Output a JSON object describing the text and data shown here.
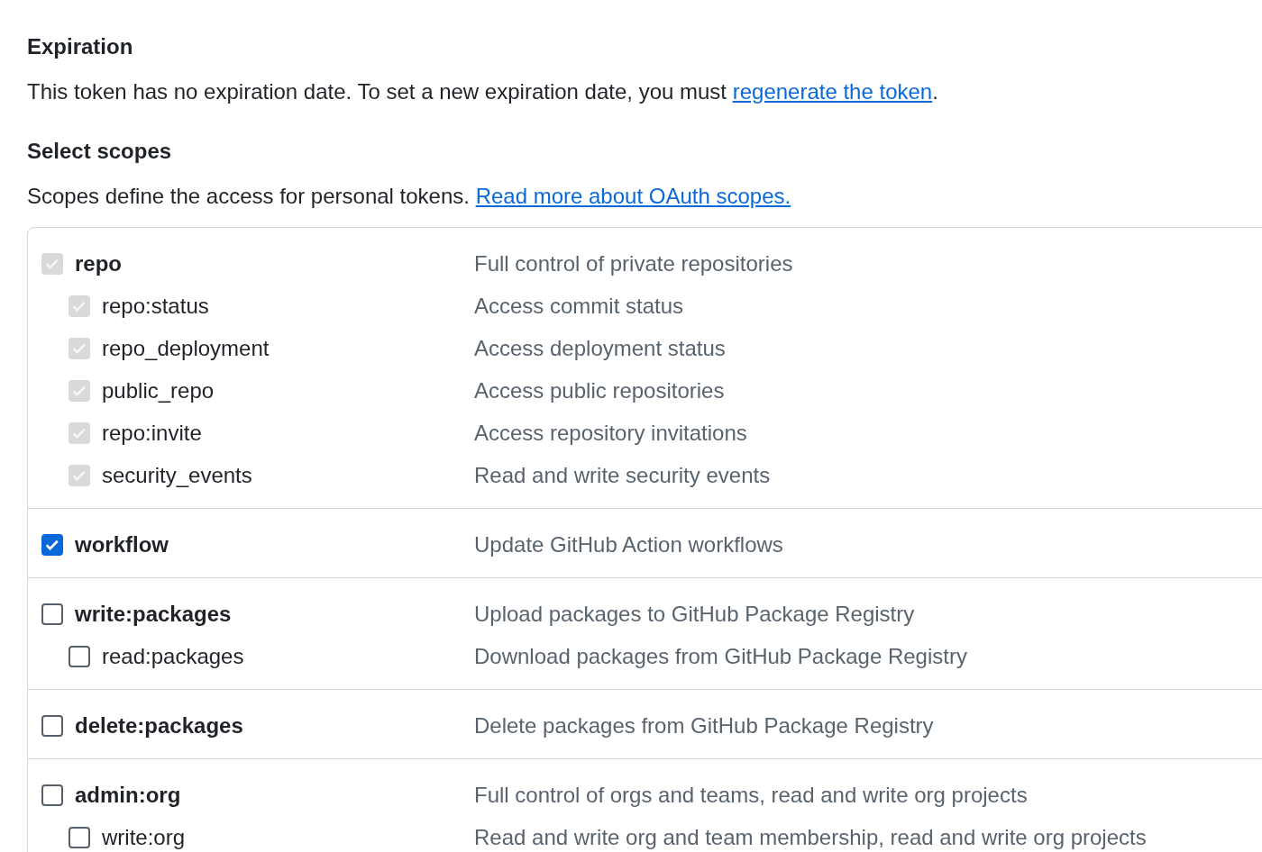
{
  "expiration": {
    "heading": "Expiration",
    "text_before": "This token has no expiration date. To set a new expiration date, you must ",
    "link": "regenerate the token",
    "text_after": "."
  },
  "scopes": {
    "heading": "Select scopes",
    "text_before": "Scopes define the access for personal tokens. ",
    "link": "Read more about OAuth scopes."
  },
  "scope_groups": [
    {
      "name": "repo",
      "description": "Full control of private repositories",
      "checked": true,
      "disabled": true,
      "children": [
        {
          "name": "repo:status",
          "description": "Access commit status",
          "checked": true,
          "disabled": true
        },
        {
          "name": "repo_deployment",
          "description": "Access deployment status",
          "checked": true,
          "disabled": true
        },
        {
          "name": "public_repo",
          "description": "Access public repositories",
          "checked": true,
          "disabled": true
        },
        {
          "name": "repo:invite",
          "description": "Access repository invitations",
          "checked": true,
          "disabled": true
        },
        {
          "name": "security_events",
          "description": "Read and write security events",
          "checked": true,
          "disabled": true
        }
      ]
    },
    {
      "name": "workflow",
      "description": "Update GitHub Action workflows",
      "checked": true,
      "disabled": false
    },
    {
      "name": "write:packages",
      "description": "Upload packages to GitHub Package Registry",
      "checked": false,
      "disabled": false,
      "children": [
        {
          "name": "read:packages",
          "description": "Download packages from GitHub Package Registry",
          "checked": false,
          "disabled": false
        }
      ]
    },
    {
      "name": "delete:packages",
      "description": "Delete packages from GitHub Package Registry",
      "checked": false,
      "disabled": false
    },
    {
      "name": "admin:org",
      "description": "Full control of orgs and teams, read and write org projects",
      "checked": false,
      "disabled": false,
      "children": [
        {
          "name": "write:org",
          "description": "Read and write org and team membership, read and write org projects",
          "checked": false,
          "disabled": false
        }
      ]
    }
  ]
}
